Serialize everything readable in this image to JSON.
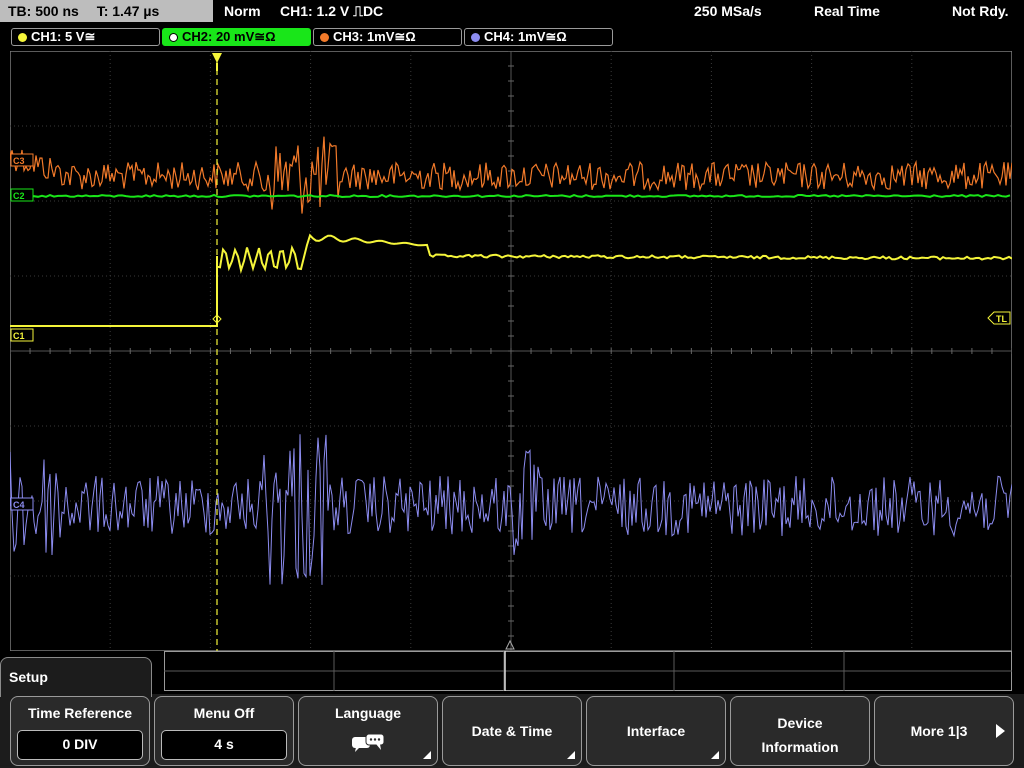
{
  "status": {
    "timebase": "TB: 500 ns",
    "trigger_time": "T: 1.47 µs",
    "mode": "Norm",
    "trigger": "CH1: 1.2 V ⎍DC",
    "sample_rate": "250 MSa/s",
    "acquisition": "Real Time",
    "state": "Not Rdy."
  },
  "channels": [
    {
      "label": "CH1: 5 V≅",
      "color": "#f5f53a",
      "active": false
    },
    {
      "label": "CH2: 20 mV≅Ω",
      "color": "#19e619",
      "active": true
    },
    {
      "label": "CH3: 1mV≅Ω",
      "color": "#f27a2a",
      "active": false
    },
    {
      "label": "CH4: 1mV≅Ω",
      "color": "#8c8cf0",
      "active": false
    }
  ],
  "markers": {
    "c1": "C1",
    "c2": "C2",
    "c3": "C3",
    "c4": "C4",
    "trigger_level": "TL"
  },
  "menu": {
    "title": "Setup",
    "keys": [
      {
        "title": "Time Reference",
        "value": "0 DIV"
      },
      {
        "title": "Menu Off",
        "value": "4 s"
      },
      {
        "title": "Language",
        "icon": "speech-bubbles-icon"
      },
      {
        "title": "Date & Time"
      },
      {
        "title": "Interface"
      },
      {
        "title": "Device",
        "title2": "Information"
      },
      {
        "title": "More 1|3"
      }
    ]
  }
}
